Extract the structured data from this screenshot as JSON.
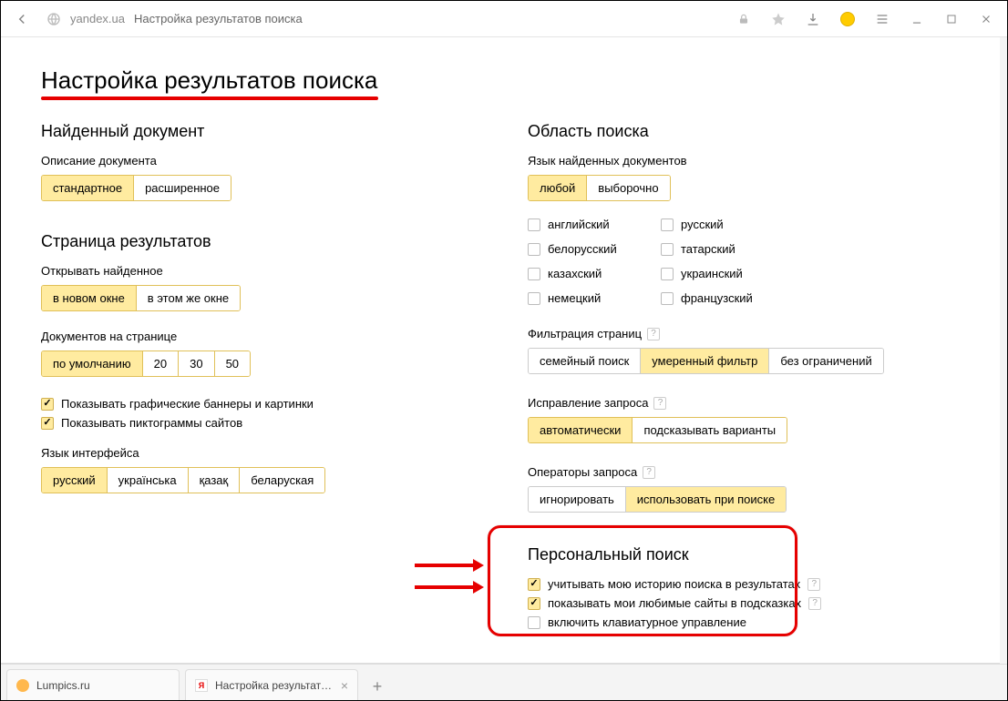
{
  "browser": {
    "domain": "yandex.ua",
    "page_title": "Настройка результатов поиска",
    "tabs": [
      {
        "label": "Lumpics.ru"
      },
      {
        "label": "Настройка результатов п"
      }
    ]
  },
  "page": {
    "heading": "Настройка результатов поиска"
  },
  "left": {
    "found_doc": {
      "title": "Найденный документ",
      "desc_label": "Описание документа",
      "opts": [
        "стандартное",
        "расширенное"
      ],
      "active": 0
    },
    "results_page": {
      "title": "Страница результатов",
      "open_label": "Открывать найденное",
      "open_opts": [
        "в новом окне",
        "в этом же окне"
      ],
      "open_active": 0,
      "perpage_label": "Документов на странице",
      "perpage_opts": [
        "по умолчанию",
        "20",
        "30",
        "50"
      ],
      "perpage_active": 0,
      "show_banners": "Показывать графические баннеры и картинки",
      "show_favicons": "Показывать пиктограммы сайтов"
    },
    "ui_lang": {
      "label": "Язык интерфейса",
      "opts": [
        "русский",
        "українська",
        "қазақ",
        "беларуская"
      ],
      "active": 0
    }
  },
  "right": {
    "search_area": {
      "title": "Область поиска",
      "docs_lang_label": "Язык найденных документов",
      "docs_lang_opts": [
        "любой",
        "выборочно"
      ],
      "docs_lang_active": 0,
      "langs_col1": [
        "английский",
        "белорусский",
        "казахский",
        "немецкий"
      ],
      "langs_col2": [
        "русский",
        "татарский",
        "украинский",
        "французский"
      ]
    },
    "filtering": {
      "label": "Фильтрация страниц",
      "opts": [
        "семейный поиск",
        "умеренный фильтр",
        "без ограничений"
      ],
      "active": 1
    },
    "correction": {
      "label": "Исправление запроса",
      "opts": [
        "автоматически",
        "подсказывать варианты"
      ],
      "active": 0
    },
    "operators": {
      "label": "Операторы запроса",
      "opts": [
        "игнорировать",
        "использовать при поиске"
      ],
      "active": 1
    },
    "personal": {
      "title": "Персональный поиск",
      "history": "учитывать мою историю поиска в результатах",
      "favsites": "показывать мои любимые сайты в подсказках",
      "keyboard": "включить клавиатурное управление",
      "history_checked": true,
      "favsites_checked": true,
      "keyboard_checked": false
    }
  }
}
